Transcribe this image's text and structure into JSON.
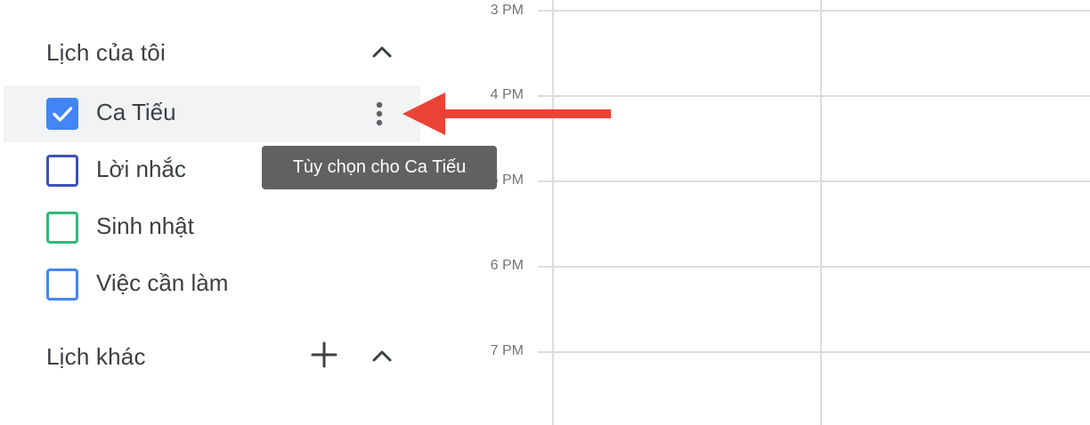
{
  "sidebar": {
    "my_calendars_title": "Lịch của tôi",
    "other_calendars_title": "Lịch khác",
    "items": [
      {
        "label": "Ca Tiếu",
        "checked": true,
        "color": "#4285f4"
      },
      {
        "label": "Lời nhắc",
        "checked": false,
        "color": "#3f51b5"
      },
      {
        "label": "Sinh nhật",
        "checked": false,
        "color": "#33b679"
      },
      {
        "label": "Việc cần làm",
        "checked": false,
        "color": "#4285f4"
      }
    ],
    "icons": {
      "collapse": "chevron-up-icon",
      "options": "more-vert-icon",
      "add": "plus-icon"
    }
  },
  "tooltip": {
    "text": "Tùy chọn cho Ca Tiếu"
  },
  "time_grid": {
    "labels": [
      "3 PM",
      "4 PM",
      "5 PM",
      "6 PM",
      "7 PM"
    ]
  },
  "annotation": {
    "arrow_color": "#ea4335"
  },
  "colors": {
    "tooltip_bg": "#616161",
    "hover_row_bg": "#f1f3f4",
    "grid_line": "#dadce0"
  }
}
